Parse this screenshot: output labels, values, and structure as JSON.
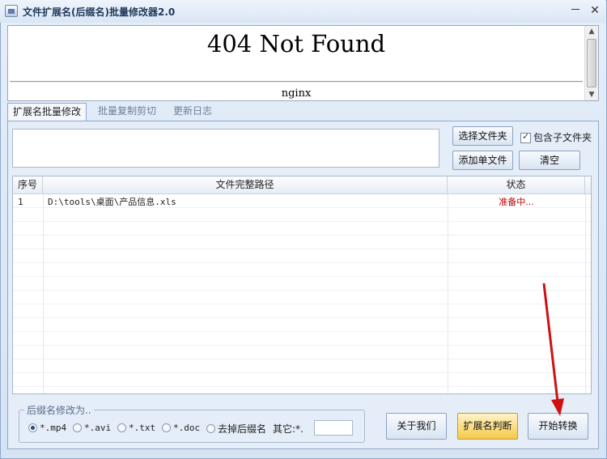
{
  "window": {
    "title": "文件扩展名(后缀名)批量修改器2.0",
    "minimize_glyph": "－",
    "close_glyph": "✕"
  },
  "browser": {
    "heading": "404 Not Found",
    "server": "nginx"
  },
  "tabs": [
    {
      "label": "扩展名批量修改",
      "active": true
    },
    {
      "label": "批量复制剪切",
      "active": false
    },
    {
      "label": "更新日志",
      "active": false
    }
  ],
  "controls": {
    "folder_path": "",
    "select_folder": "选择文件夹",
    "include_subfolders": "包含子文件夹",
    "include_subfolders_checked": true,
    "add_file": "添加单文件",
    "clear": "清空"
  },
  "table": {
    "columns": [
      "序号",
      "文件完整路径",
      "状态"
    ],
    "rows": [
      {
        "no": "1",
        "path": "D:\\tools\\桌面\\产品信息.xls",
        "status": "准备中..."
      }
    ]
  },
  "extension_group": {
    "legend": "后缀名修改为..",
    "options": [
      {
        "label": "*.mp4",
        "checked": true
      },
      {
        "label": "*.avi",
        "checked": false
      },
      {
        "label": "*.txt",
        "checked": false
      },
      {
        "label": "*.doc",
        "checked": false
      },
      {
        "label": "去掉后缀名",
        "checked": false
      }
    ],
    "other_label": "其它:*.",
    "other_value": ""
  },
  "buttons": {
    "about": "关于我们",
    "judge": "扩展名判断",
    "start": "开始转换"
  },
  "colors": {
    "status_text": "#c00000",
    "judge_button": "#f5c94a",
    "annotation_arrow": "#d01010"
  }
}
